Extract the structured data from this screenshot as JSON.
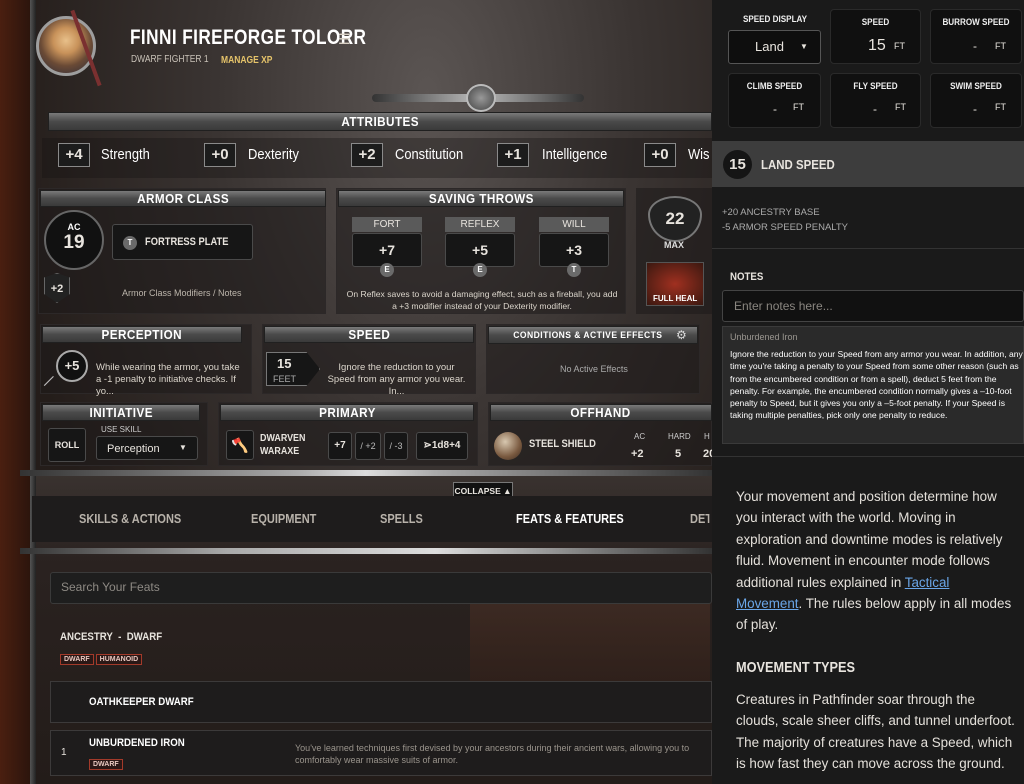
{
  "character": {
    "name": "FINNI FIREFORGE TOLORR",
    "subtitle": "DWARF FIGHTER 1",
    "manage_xp": "MANAGE XP"
  },
  "attributes": {
    "title": "ATTRIBUTES",
    "items": [
      {
        "mod": "+4",
        "name": "Strength"
      },
      {
        "mod": "+0",
        "name": "Dexterity"
      },
      {
        "mod": "+2",
        "name": "Constitution"
      },
      {
        "mod": "+1",
        "name": "Intelligence"
      },
      {
        "mod": "+0",
        "name": "Wis"
      }
    ]
  },
  "armor_class": {
    "title": "ARMOR CLASS",
    "ac_label": "AC",
    "ac": "19",
    "armor_tag": "T",
    "armor_name": "FORTRESS PLATE",
    "shield_bonus": "+2",
    "notes": "Armor Class Modifiers / Notes"
  },
  "saving_throws": {
    "title": "SAVING THROWS",
    "items": [
      {
        "label": "FORT",
        "value": "+7",
        "prof": "E"
      },
      {
        "label": "REFLEX",
        "value": "+5",
        "prof": "E"
      },
      {
        "label": "WILL",
        "value": "+3",
        "prof": "T"
      }
    ],
    "note": "On Reflex saves to avoid a damaging effect, such as a fireball, you add a +3 modifier instead of your Dexterity modifier."
  },
  "hp": {
    "value": "22",
    "label": "MAX",
    "full_heal": "FULL HEAL"
  },
  "perception": {
    "title": "PERCEPTION",
    "value": "+5",
    "note": "While wearing the armor, you take a -1 penalty to initiative checks. If yo..."
  },
  "speed": {
    "title": "SPEED",
    "value": "15",
    "unit": "FEET",
    "note": "Ignore the reduction to your Speed from any armor you wear. In..."
  },
  "conditions": {
    "title": "CONDITIONS & ACTIVE EFFECTS",
    "empty": "No Active Effects"
  },
  "initiative": {
    "title": "INITIATIVE",
    "roll": "ROLL",
    "use_skill": "USE SKILL",
    "skill": "Perception"
  },
  "primary": {
    "title": "PRIMARY",
    "weapon": "DWARVEN WARAXE",
    "hit": "+7",
    "m2": "/ +2",
    "m3": "/ -3",
    "damage": "⋗1d8+4"
  },
  "offhand": {
    "title": "OFFHAND",
    "item": "STEEL SHIELD",
    "cols": [
      {
        "label": "AC",
        "value": "+2"
      },
      {
        "label": "HARD",
        "value": "5"
      },
      {
        "label": "H",
        "value": "20"
      }
    ]
  },
  "collapse": "COLLAPSE",
  "tabs": [
    "SKILLS & ACTIONS",
    "EQUIPMENT",
    "SPELLS",
    "FEATS & FEATURES",
    "DETA"
  ],
  "feats": {
    "search_placeholder": "Search Your Feats",
    "ancestry_heading": "ANCESTRY  -  DWARF",
    "tags": [
      "DWARF",
      "HUMANOID"
    ],
    "rows": [
      {
        "name": "OATHKEEPER DWARF"
      },
      {
        "level": "1",
        "name": "UNBURDENED IRON",
        "tag": "DWARF",
        "desc": "You've learned techniques first devised by your ancestors during their ancient wars, allowing you to comfortably wear massive suits of armor."
      }
    ]
  },
  "speed_panel": {
    "display_label": "SPEED DISPLAY",
    "display_value": "Land",
    "boxes": [
      {
        "label": "SPEED",
        "value": "15",
        "unit": "FT"
      },
      {
        "label": "BURROW SPEED",
        "value": "-",
        "unit": "FT"
      },
      {
        "label": "CLIMB SPEED",
        "value": "-",
        "unit": "FT"
      },
      {
        "label": "FLY SPEED",
        "value": "-",
        "unit": "FT"
      },
      {
        "label": "SWIM SPEED",
        "value": "-",
        "unit": "FT"
      }
    ],
    "land_value": "15",
    "land_label": "LAND SPEED",
    "mods": [
      "+20 ANCESTRY BASE",
      "-5 ARMOR SPEED PENALTY"
    ],
    "notes_label": "NOTES",
    "notes_placeholder": "Enter notes here...",
    "tooltip_title": "Unburdened Iron",
    "tooltip_text": "Ignore the reduction to your Speed from any armor you wear. In addition, any time you're taking a penalty to your Speed from some other reason (such as from the encumbered condition or from a spell), deduct 5 feet from the penalty. For example, the encumbered condition normally gives a –10-foot penalty to Speed, but it gives you only a –5-foot penalty. If your Speed is taking multiple penalties, pick only one penalty to reduce.",
    "desc_1": "Your movement and position determine how you interact with the world. Moving in exploration and downtime modes is relatively fluid. Movement in encounter mode follows additional rules explained in ",
    "desc_link": "Tactical Movement",
    "desc_2": ". The rules below apply in all modes of play.",
    "types_heading": "MOVEMENT TYPES",
    "types_text": "Creatures in Pathfinder soar through the clouds, scale sheer cliffs, and tunnel underfoot. The majority of creatures have a Speed, which is how fast they can move across the ground."
  },
  "colors": {
    "accent": "#e6c46a",
    "link": "#6aa6e8",
    "tag_border": "#a33a2a"
  }
}
